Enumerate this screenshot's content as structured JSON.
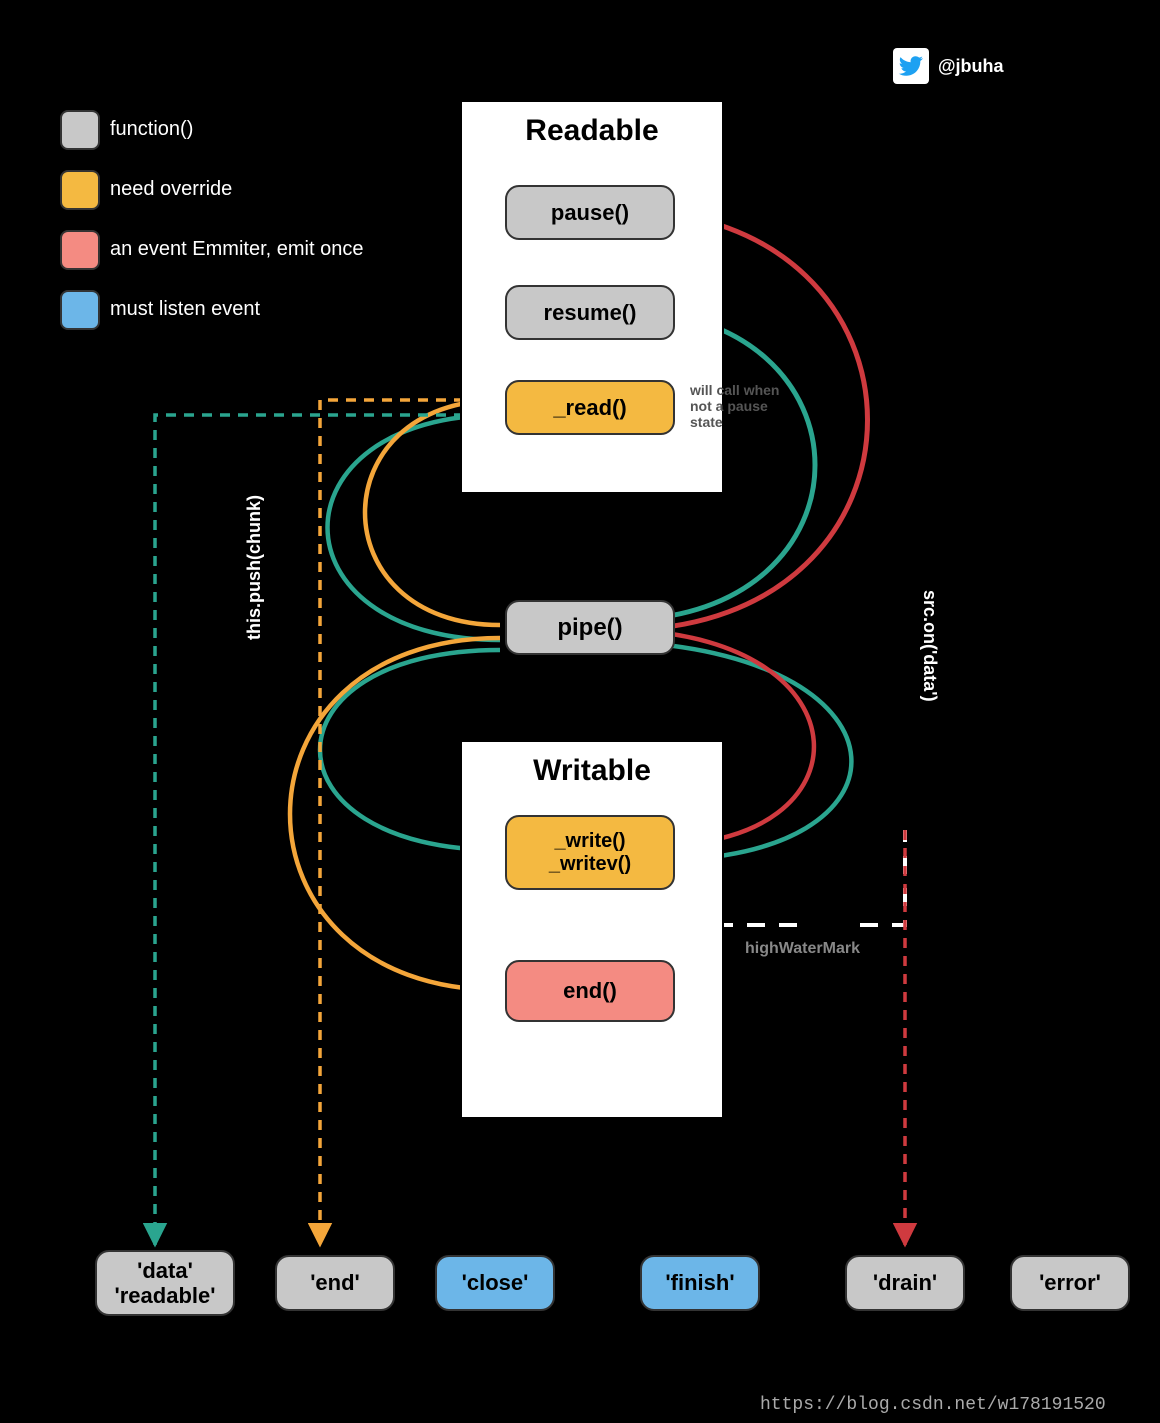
{
  "meta": {
    "twitter_handle": "@jbuha",
    "credit": "https://blog.csdn.net/w178191520"
  },
  "legend": [
    {
      "color": "grey",
      "label": "function()"
    },
    {
      "color": "orange",
      "label": "need override"
    },
    {
      "color": "red",
      "label": "an event Emmiter, emit once"
    },
    {
      "color": "blue",
      "label": "must listen event"
    }
  ],
  "panels": {
    "readable": {
      "title": "Readable"
    },
    "writable": {
      "title": "Writable"
    }
  },
  "nodes": {
    "pause": "pause()",
    "resume": "resume()",
    "read": "_read()",
    "pipe": "pipe()",
    "write": {
      "l1": "_write()",
      "l2": "_writev()"
    },
    "end": "end()"
  },
  "note_read": {
    "l1": "will call when",
    "l2": "not a pause",
    "l3": "state"
  },
  "events": {
    "data": {
      "l1": "'data'",
      "l2": "'readable'"
    },
    "end": "'end'",
    "close": "'close'",
    "finish": "'finish'",
    "drain": "'drain'",
    "error": "'error'"
  },
  "side_labels": {
    "left": "this.push(chunk)",
    "right": "src.on('data')"
  },
  "hwm": "highWaterMark",
  "colors": {
    "teal": "#2aa58f",
    "orange": "#f4a63a",
    "crimson": "#cf3a3f",
    "black": "#000"
  }
}
